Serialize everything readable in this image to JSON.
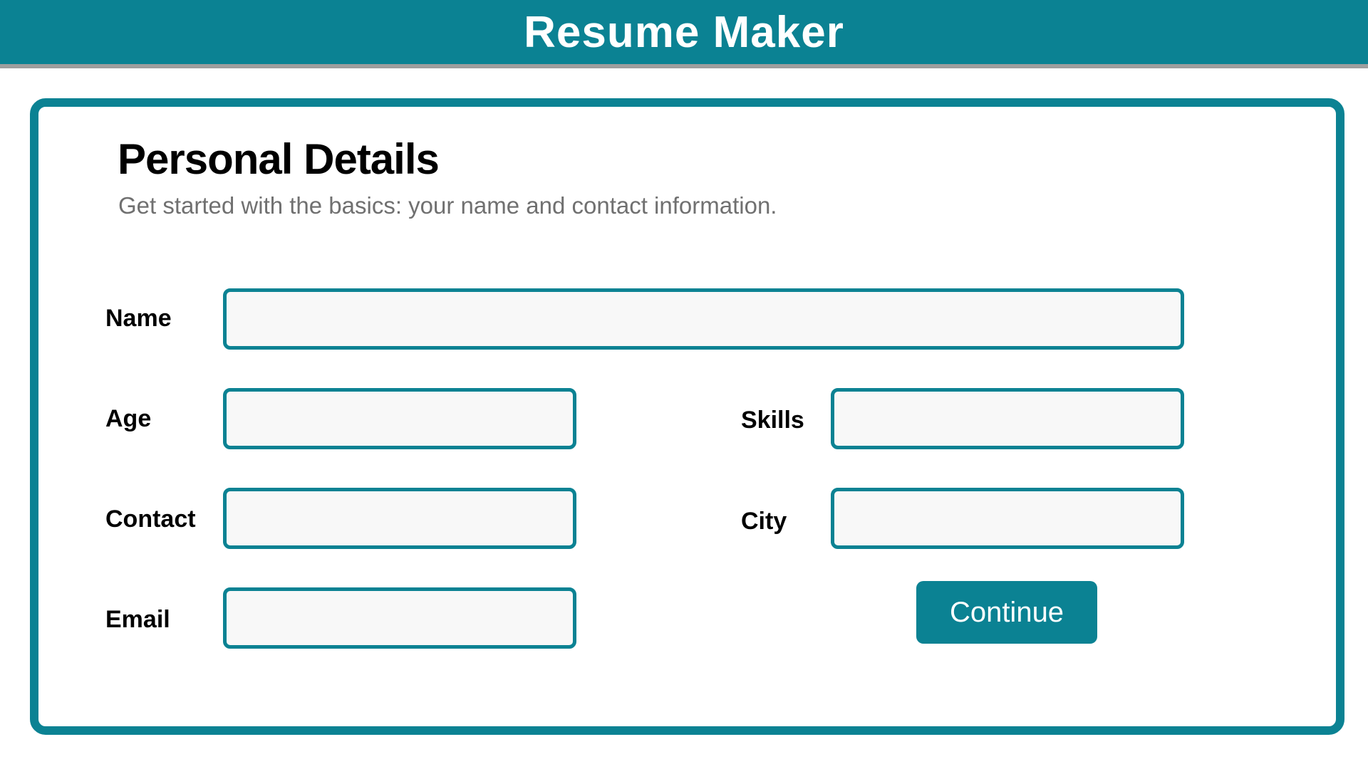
{
  "app": {
    "title": "Resume Maker"
  },
  "section": {
    "title": "Personal Details",
    "subtitle": "Get started with the basics: your name and contact information."
  },
  "fields": {
    "name": {
      "label": "Name",
      "value": "",
      "placeholder": ""
    },
    "age": {
      "label": "Age",
      "value": "",
      "placeholder": ""
    },
    "skills": {
      "label": "Skills",
      "value": "",
      "placeholder": ""
    },
    "contact": {
      "label": "Contact",
      "value": "",
      "placeholder": ""
    },
    "city": {
      "label": "City",
      "value": "",
      "placeholder": ""
    },
    "email": {
      "label": "Email",
      "value": "",
      "placeholder": ""
    }
  },
  "actions": {
    "continue_label": "Continue"
  },
  "colors": {
    "accent": "#0b8293",
    "header_border": "#9e9e9e",
    "input_background": "#f8f8f8",
    "subtitle_text": "#707070"
  }
}
